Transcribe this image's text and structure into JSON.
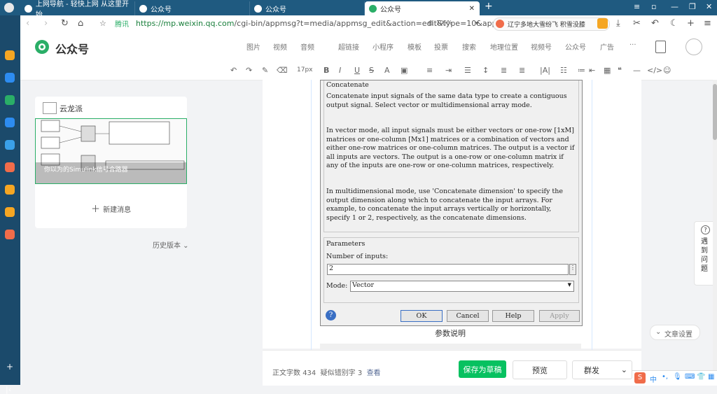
{
  "browser": {
    "tabs": [
      {
        "label": "上网导航 - 轻快上网 从这里开始",
        "active": false
      },
      {
        "label": "公众号",
        "active": false
      },
      {
        "label": "公众号",
        "active": false
      },
      {
        "label": "公众号",
        "active": true
      }
    ],
    "url_host": "https://mp.weixin.qq.com",
    "url_path": "/cgi-bin/appmsg?t=media/appmsg_edit&action=edit&type=10&app",
    "secure_label": "腾讯",
    "zoom_level": "105%",
    "search_text": "辽宁多地大雪纷飞 积雪没膝"
  },
  "header": {
    "logo_text": "公众号",
    "tools": [
      "图片",
      "视频",
      "音频",
      "超链接",
      "小程序",
      "模板",
      "投票",
      "搜索",
      "地理位置",
      "视频号",
      "公众号",
      "广告",
      "···"
    ]
  },
  "format_toolbar": {
    "font_size": "17px"
  },
  "left_panel": {
    "account_name": "云龙派",
    "thumbnail_caption": "你以为的Simulink信号合路器",
    "new_message": "新建消息",
    "history": "历史版本"
  },
  "dialog": {
    "section_title": "Concatenate",
    "paragraph1": "Concatenate input signals of the same data type to create a contiguous output signal. Select vector or multidimensional array mode.",
    "paragraph2": "In vector mode, all input signals must be either vectors or one-row [1xM] matrices or one-column [Mx1] matrices or a combination of vectors and either one-row matrices or one-column matrices. The output is a vector if all inputs are vectors. The output is a one-row or one-column matrix if any of the inputs are one-row or one-column matrices, respectively.",
    "paragraph3": "In multidimensional mode, use 'Concatenate dimension' to specify the output dimension along which to concatenate the input arrays. For example, to concatenate the input arrays vertically or horizontally, specify 1 or 2, respectively, as the concatenate dimensions.",
    "params_title": "Parameters",
    "inputs_label": "Number of inputs:",
    "inputs_value": "2",
    "mode_label": "Mode:",
    "mode_value": "Vector",
    "buttons": {
      "ok": "OK",
      "cancel": "Cancel",
      "help": "Help",
      "apply": "Apply"
    }
  },
  "image_caption": "参数说明",
  "bottom_bar": {
    "word_count_label": "正文字数",
    "word_count_value": "434",
    "typo_label": "疑似错别字",
    "typo_value": "3",
    "view_link": "查看",
    "save_draft": "保存为草稿",
    "preview": "预览",
    "publish": "群发"
  },
  "side": {
    "to_question": "遇到问题",
    "article_settings": "文章设置"
  },
  "ime": {
    "lang": "中"
  },
  "colors": {
    "wechat_green": "#07c160",
    "browser_blue": "#1f5a80",
    "link_blue": "#576b95"
  }
}
